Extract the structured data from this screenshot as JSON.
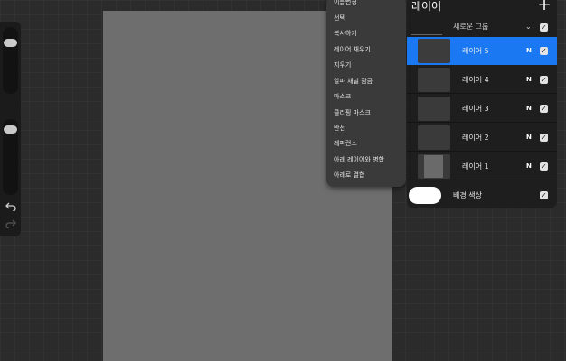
{
  "canvas": {
    "color": "#6e6e6e"
  },
  "sidebar": {
    "brush_size_level": 0.9,
    "opacity_level": 0.95,
    "modify_icon": "square-icon",
    "undo_icon": "undo-arrow-icon",
    "redo_icon": "redo-arrow-icon"
  },
  "context_menu": {
    "items": [
      "이름변경",
      "선택",
      "복사하기",
      "레이어 채우기",
      "지우기",
      "알파 채널 잠금",
      "마스크",
      "클리핑 마스크",
      "반전",
      "레퍼런스",
      "아래 레이어와 병합",
      "아래로 결합"
    ]
  },
  "layers": {
    "title": "레이어",
    "add_label": "+",
    "group": {
      "name": "새로운 그룹",
      "chevron": "⌄"
    },
    "items": [
      {
        "name": "레이어 5",
        "blend": "N",
        "visible": true,
        "selected": true
      },
      {
        "name": "레이어 4",
        "blend": "N",
        "visible": true,
        "selected": false
      },
      {
        "name": "레이어 3",
        "blend": "N",
        "visible": true,
        "selected": false
      },
      {
        "name": "레이어 2",
        "blend": "N",
        "visible": true,
        "selected": false
      },
      {
        "name": "레이어 1",
        "blend": "N",
        "visible": true,
        "selected": false
      }
    ],
    "background": {
      "name": "배경 색상",
      "color": "#ffffff",
      "visible": true
    }
  },
  "colors": {
    "accent": "#1a79f2",
    "panel": "#1e1e1e",
    "menu": "#3a3a3a"
  }
}
